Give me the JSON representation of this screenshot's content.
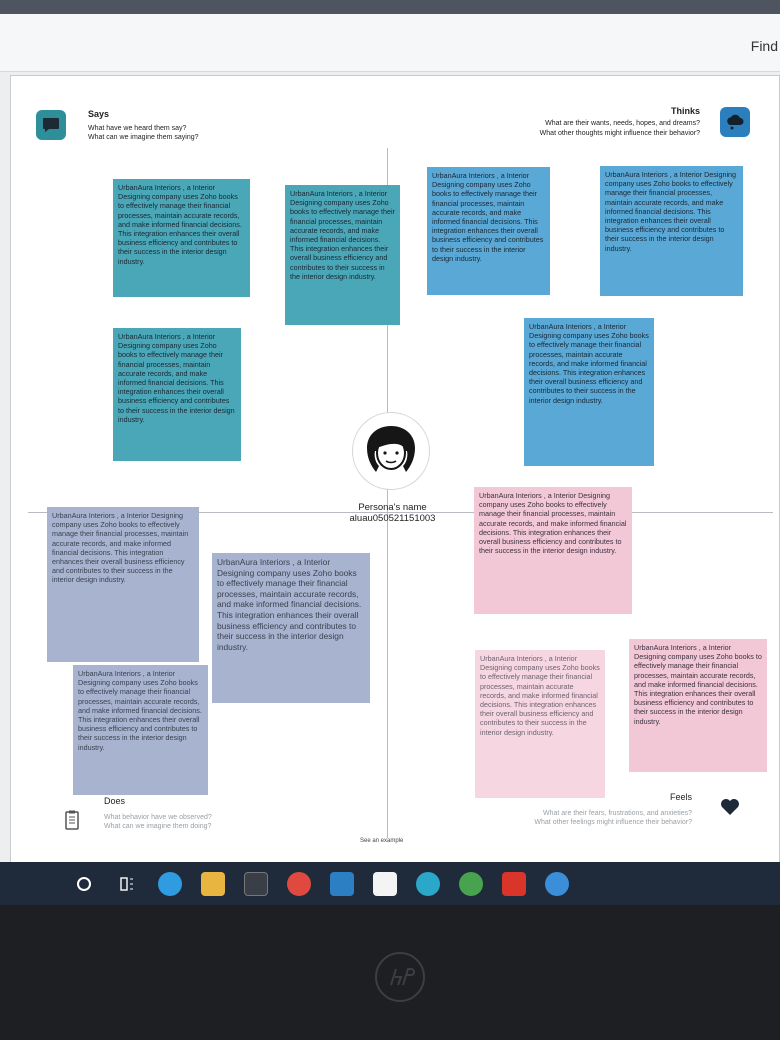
{
  "toolbar": {
    "find_label": "Find"
  },
  "says": {
    "title": "Says",
    "line1": "What have we heard them say?",
    "line2": "What can we imagine them saying?"
  },
  "thinks": {
    "title": "Thinks",
    "line1": "What are their wants, needs, hopes, and dreams?",
    "line2": "What other thoughts might influence their behavior?"
  },
  "does": {
    "title": "Does",
    "line1": "What behavior have we observed?",
    "line2": "What can we imagine them doing?"
  },
  "feels": {
    "title": "Feels",
    "line1": "What are their fears, frustrations, and anxieties?",
    "line2": "What other feelings might influence their behavior?"
  },
  "persona": {
    "name_label": "Persona's name",
    "id": "aluau050521151003"
  },
  "notes": {
    "n1": "UrbanAura Interiors , a Interior Designing company uses Zoho books to effectively manage their financial processes, maintain accurate records, and make informed financial decisions. This integration enhances their overall business efficiency and contributes to their success in the interior design industry.",
    "n2": "UrbanAura Interiors , a Interior Designing company uses Zoho books to effectively manage their financial processes, maintain accurate records, and make informed financial decisions. This integration enhances their overall business efficiency and contributes to their success in the interior design industry.",
    "n3": "UrbanAura Interiors , a Interior Designing company uses Zoho books to effectively manage their financial processes, maintain accurate records, and make informed financial decisions. This integration enhances their overall business efficiency and contributes to their success in the interior design industry.",
    "n4": "UrbanAura Interiors , a Interior Designing company uses Zoho books to effectively manage their financial processes, maintain accurate records, and make informed financial decisions. This integration enhances their overall business efficiency and contributes to their success in the interior design industry.",
    "n5": "UrbanAura Interiors , a Interior Designing company uses Zoho books to effectively manage their financial processes, maintain accurate records, and make informed financial decisions. This integration enhances their overall business efficiency and contributes to their success in the interior design industry.",
    "n6": "UrbanAura Interiors , a Interior Designing company uses Zoho books to effectively manage their financial processes, maintain accurate records, and make informed financial decisions. This integration enhances their overall business efficiency and contributes to their success in the interior design industry.",
    "n7": "UrbanAura Interiors , a Interior Designing company uses Zoho books to effectively manage their financial processes, maintain accurate records, and make informed financial decisions. This integration enhances their overall business efficiency and contributes to their success in the interior design industry.",
    "n8": "UrbanAura Interiors , a Interior Designing company uses Zoho books to effectively manage their financial processes, maintain accurate records, and make informed financial decisions. This integration enhances their overall business efficiency and contributes to their success in the interior design industry.",
    "n9": "UrbanAura Interiors , a Interior Designing company uses Zoho books to effectively manage their financial processes, maintain accurate records, and make informed financial decisions. This integration enhances their overall business efficiency and contributes to their success in the interior design industry.",
    "n10": "UrbanAura Interiors , a Interior Designing company uses Zoho books to effectively manage their financial processes, maintain accurate records, and make informed financial decisions. This integration enhances their overall business efficiency and contributes to their success in the interior design industry.",
    "n11": "UrbanAura Interiors , a Interior Designing company uses Zoho books to effectively manage their financial processes, maintain accurate records, and make informed financial decisions. This integration enhances their overall business efficiency and contributes to their success in the interior design industry.",
    "n12": "UrbanAura Interiors , a Interior Designing company uses Zoho books to effectively manage their financial processes, maintain accurate records, and make informed financial decisions. This integration enhances their overall business efficiency and contributes to their success in the interior design industry."
  },
  "example_link": "See an example",
  "colors": {
    "says_teal": "#4aa7b8",
    "thinks_blue": "#5aa8d6",
    "does_purple": "#a8b3cf",
    "feels_pink": "#f2c7d6",
    "taskbar": "#1f2a3a"
  },
  "icons": {
    "says": "speech-bubble-icon",
    "thinks": "thought-cloud-icon",
    "does": "notepad-icon",
    "feels": "heart-icon",
    "persona": "persona-avatar-icon"
  },
  "taskbar_icons": [
    "start-icon",
    "task-view-icon",
    "edge-icon",
    "file-explorer-icon",
    "calculator-icon",
    "opera-icon",
    "mail-icon",
    "notes-icon",
    "store-icon",
    "chrome-icon",
    "acrobat-icon",
    "help-icon"
  ]
}
